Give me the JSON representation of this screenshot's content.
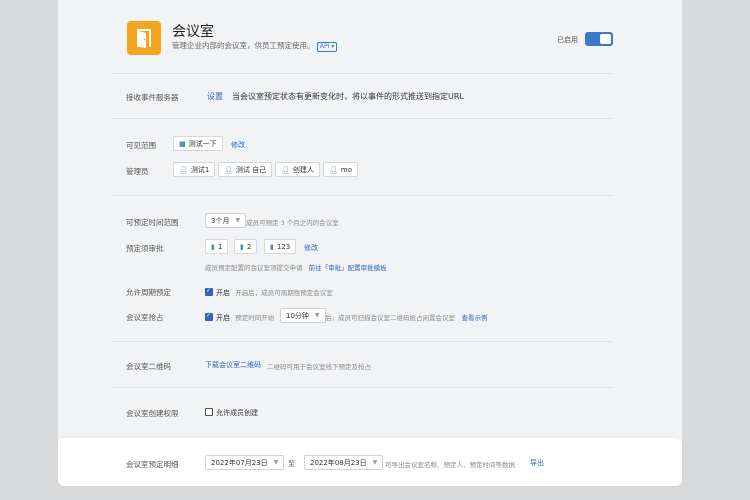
{
  "header": {
    "title": "会议室",
    "description": "管理企业内部的会议室，供员工预定使用。",
    "api_badge": "API ▾",
    "status_label": "已启用"
  },
  "event_server": {
    "label": "接收事件服务器",
    "setting_link": "设置",
    "description": "当会议室预定状态有更新变化时，将以事件的形式推送到指定URL"
  },
  "visibility": {
    "label": "可见范围",
    "chip": "测试一下",
    "edit": "修改"
  },
  "admins": {
    "label": "管理员",
    "items": [
      "测试1",
      "测试 自己",
      "创建人",
      "mo"
    ]
  },
  "booking_range": {
    "label": "可预定时间范围",
    "value": "3个月",
    "hint": "成员可预定 3 个月之内的会议室"
  },
  "approval": {
    "label": "预定须审批",
    "rooms": [
      "1",
      "2",
      "123"
    ],
    "edit": "修改",
    "hint": "成员预定配置的会议室须提交申请",
    "hint_link": "前往「审批」配置审批模板"
  },
  "recurring": {
    "label": "允许周期预定",
    "checkbox_label": "开启",
    "hint": "开启后，成员可周期性预定会议室"
  },
  "checkin": {
    "label": "会议室抢占",
    "checkbox_label": "开启",
    "prefix": "预定时间开始",
    "value": "10分钟",
    "suffix": "后，成员可扫描会议室二维码抢占闲置会议室",
    "example_link": "查看示例"
  },
  "qrcode": {
    "label": "会议室二维码",
    "download_link": "下载会议室二维码",
    "hint": "二维码可用于会议室线下预定及抢占"
  },
  "create_permission": {
    "label": "会议室创建权限",
    "checkbox_label": "允许成员创建"
  },
  "booking_details": {
    "label": "会议室预定明细",
    "start_date": "2022年07月23日",
    "to": "至",
    "end_date": "2022年08月23日",
    "hint": "可导出会议室名称、预定人、预定时间等数据",
    "export_link": "导出"
  }
}
